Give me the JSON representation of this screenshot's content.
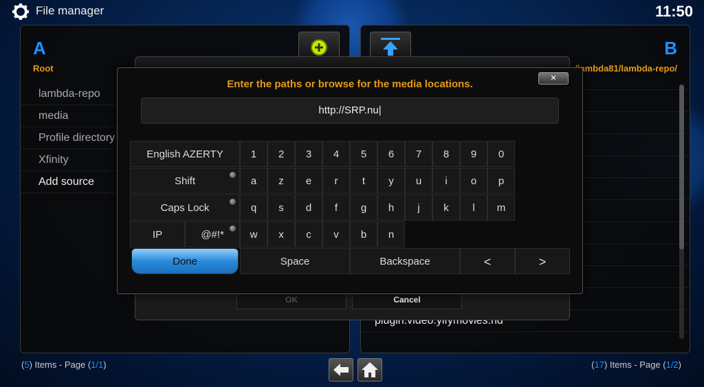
{
  "header": {
    "title": "File manager",
    "clock": "11:50"
  },
  "left_panel": {
    "letter": "A",
    "path": "Root",
    "items": [
      "lambda-repo",
      "media",
      "Profile directory",
      "Xfinity",
      "Add source"
    ],
    "footer": {
      "count": "5",
      "items_label": "Items - Page",
      "page": "1/1"
    }
  },
  "right_panel": {
    "letter": "B",
    "path": "/lambda81/lambda-repo/",
    "items": [
      "",
      "",
      "",
      "",
      "",
      "",
      "",
      "",
      "",
      "",
      "",
      "plugin.video.yifymovies.hd"
    ],
    "footer": {
      "count": "17",
      "items_label": "Items - Page",
      "page": "1/2"
    }
  },
  "source_dialog": {
    "ok_label": "OK",
    "cancel_label": "Cancel"
  },
  "keyboard": {
    "title": "Enter the paths or browse for the media locations.",
    "input_value": "http://SRP.nu",
    "close_label": "✕",
    "layout_label": "English AZERTY",
    "shift_label": "Shift",
    "caps_label": "Caps Lock",
    "ip_label": "IP",
    "symbols_label": "@#!*",
    "row_numbers": [
      "1",
      "2",
      "3",
      "4",
      "5",
      "6",
      "7",
      "8",
      "9",
      "0"
    ],
    "row_1": [
      "a",
      "z",
      "e",
      "r",
      "t",
      "y",
      "u",
      "i",
      "o",
      "p"
    ],
    "row_2": [
      "q",
      "s",
      "d",
      "f",
      "g",
      "h",
      "j",
      "k",
      "l",
      "m"
    ],
    "row_3": [
      "w",
      "x",
      "c",
      "v",
      "b",
      "n"
    ],
    "done_label": "Done",
    "space_label": "Space",
    "backspace_label": "Backspace",
    "left_label": "<",
    "right_label": ">"
  },
  "colors": {
    "accent_blue": "#1e90ff",
    "accent_orange": "#e89a16"
  },
  "icons": [
    "gear-icon",
    "add-source-icon",
    "up-folder-icon",
    "back-arrow-icon",
    "home-icon"
  ]
}
